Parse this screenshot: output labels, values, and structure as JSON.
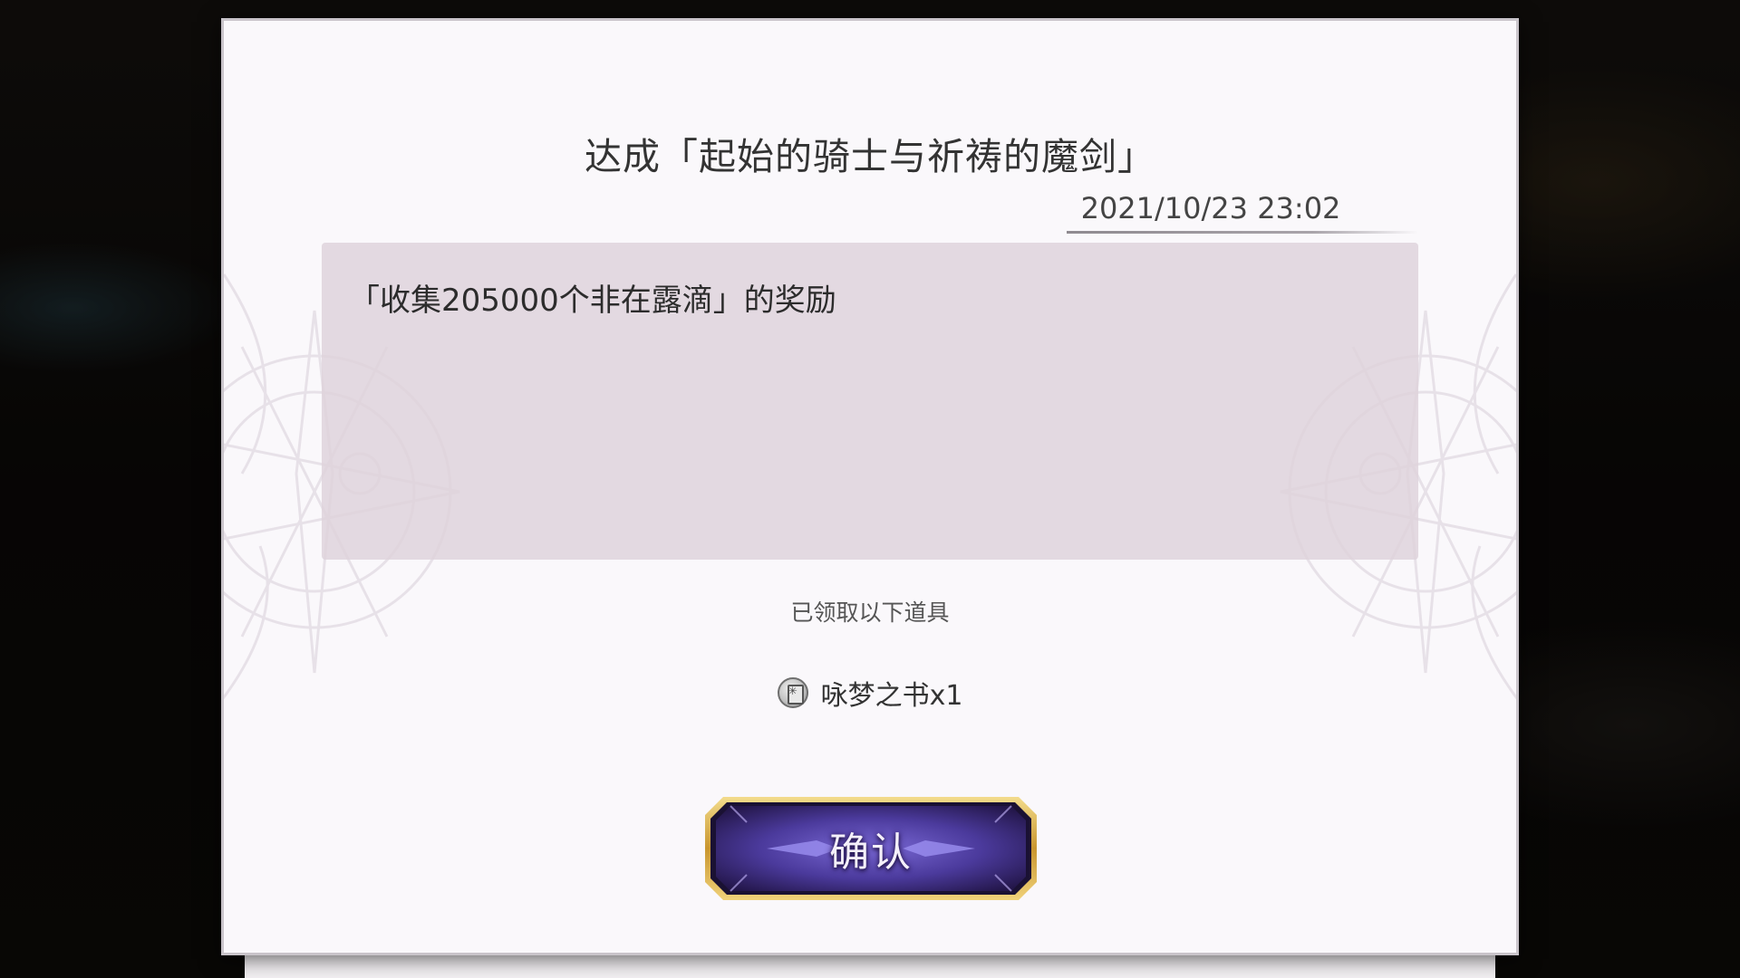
{
  "dialog": {
    "title": "达成「起始的骑士与祈祷的魔剑」",
    "date": "2021/10/23 23:02",
    "message": "「收集205000个非在露滴」的奖励",
    "received_label": "已领取以下道具",
    "item": {
      "icon": "book-icon",
      "name": "咏梦之书x1"
    },
    "confirm_label": "确认"
  },
  "colors": {
    "panel": "#faf8fb",
    "message_box": "#e2d6de",
    "button_purple": "#4a3a9a",
    "button_gold": "#d6b04a"
  }
}
